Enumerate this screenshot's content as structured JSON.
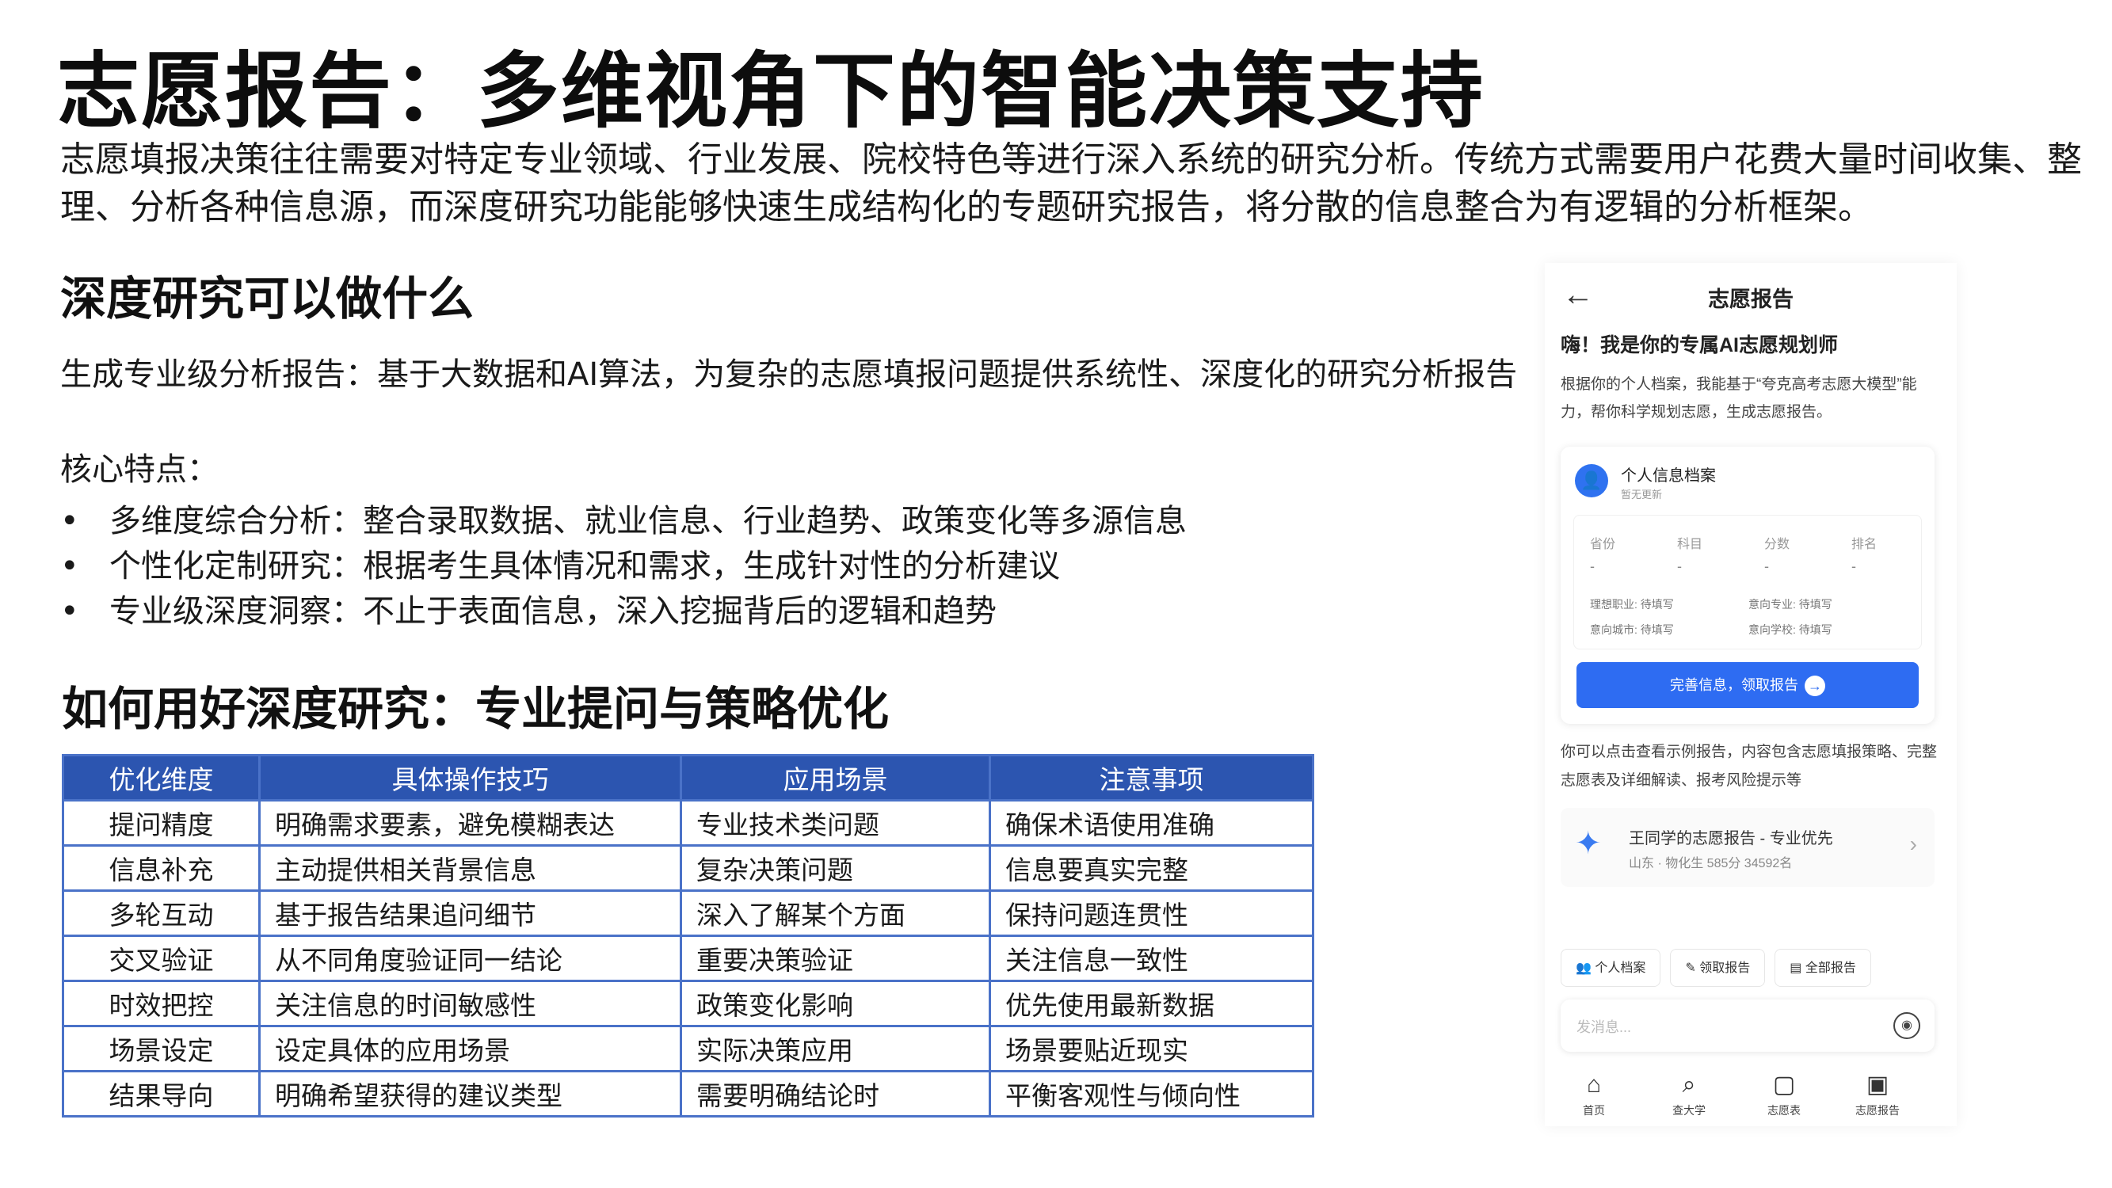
{
  "title": "志愿报告：多维视角下的智能决策支持",
  "intro": "志愿填报决策往往需要对特定专业领域、行业发展、院校特色等进行深入系统的研究分析。传统方式需要用户花费大量时间收集、整理、分析各种信息源，而深度研究功能能够快速生成结构化的专题研究报告，将分散的信息整合为有逻辑的分析框架。",
  "section1": {
    "heading": "深度研究可以做什么",
    "summary": "生成专业级分析报告：基于大数据和AI算法，为复杂的志愿填报问题提供系统性、深度化的研究分析报告",
    "features_label": "核心特点：",
    "bullets": [
      "多维度综合分析：整合录取数据、就业信息、行业趋势、政策变化等多源信息",
      "个性化定制研究：根据考生具体情况和需求，生成针对性的分析建议",
      "专业级深度洞察：不止于表面信息，深入挖掘背后的逻辑和趋势"
    ]
  },
  "section2": {
    "heading": "如何用好深度研究：专业提问与策略优化"
  },
  "table": {
    "headers": [
      "优化维度",
      "具体操作技巧",
      "应用场景",
      "注意事项"
    ],
    "rows": [
      [
        "提问精度",
        "明确需求要素，避免模糊表达",
        "专业技术类问题",
        "确保术语使用准确"
      ],
      [
        "信息补充",
        "主动提供相关背景信息",
        "复杂决策问题",
        "信息要真实完整"
      ],
      [
        "多轮互动",
        "基于报告结果追问细节",
        "深入了解某个方面",
        "保持问题连贯性"
      ],
      [
        "交叉验证",
        "从不同角度验证同一结论",
        "重要决策验证",
        "关注信息一致性"
      ],
      [
        "时效把控",
        "关注信息的时间敏感性",
        "政策变化影响",
        "优先使用最新数据"
      ],
      [
        "场景设定",
        "设定具体的应用场景",
        "实际决策应用",
        "场景要贴近现实"
      ],
      [
        "结果导向",
        "明确希望获得的建议类型",
        "需要明确结论时",
        "平衡客观性与倾向性"
      ]
    ]
  },
  "phone": {
    "back_icon": "←",
    "title": "志愿报告",
    "greeting": "嗨！我是你的专属AI志愿规划师",
    "desc": "根据你的个人档案，我能基于“夸克高考志愿大模型”能力，帮你科学规划志愿，生成志愿报告。",
    "card": {
      "avatar_icon": "user-icon",
      "title": "个人信息档案",
      "subtitle": "暂无更新",
      "columns": [
        "省份",
        "科目",
        "分数",
        "排名"
      ],
      "values": [
        "-",
        "-",
        "-",
        "-"
      ],
      "kv": [
        {
          "k": "理想职业:",
          "v": "待填写"
        },
        {
          "k": "意向专业:",
          "v": "待填写"
        },
        {
          "k": "意向城市:",
          "v": "待填写"
        },
        {
          "k": "意向学校:",
          "v": "待填写"
        }
      ],
      "button": "完善信息，领取报告"
    },
    "hint": "你可以点击查看示例报告，内容包含志愿填报策略、完整志愿表及详细解读、报考风险提示等",
    "sample": {
      "title": "王同学的志愿报告 - 专业优先",
      "subtitle": "山东 · 物化生 585分 34592名"
    },
    "chips": [
      "个人档案",
      "领取报告",
      "全部报告"
    ],
    "input_placeholder": "发消息...",
    "tabs": [
      "首页",
      "查大学",
      "志愿表",
      "志愿报告"
    ]
  }
}
